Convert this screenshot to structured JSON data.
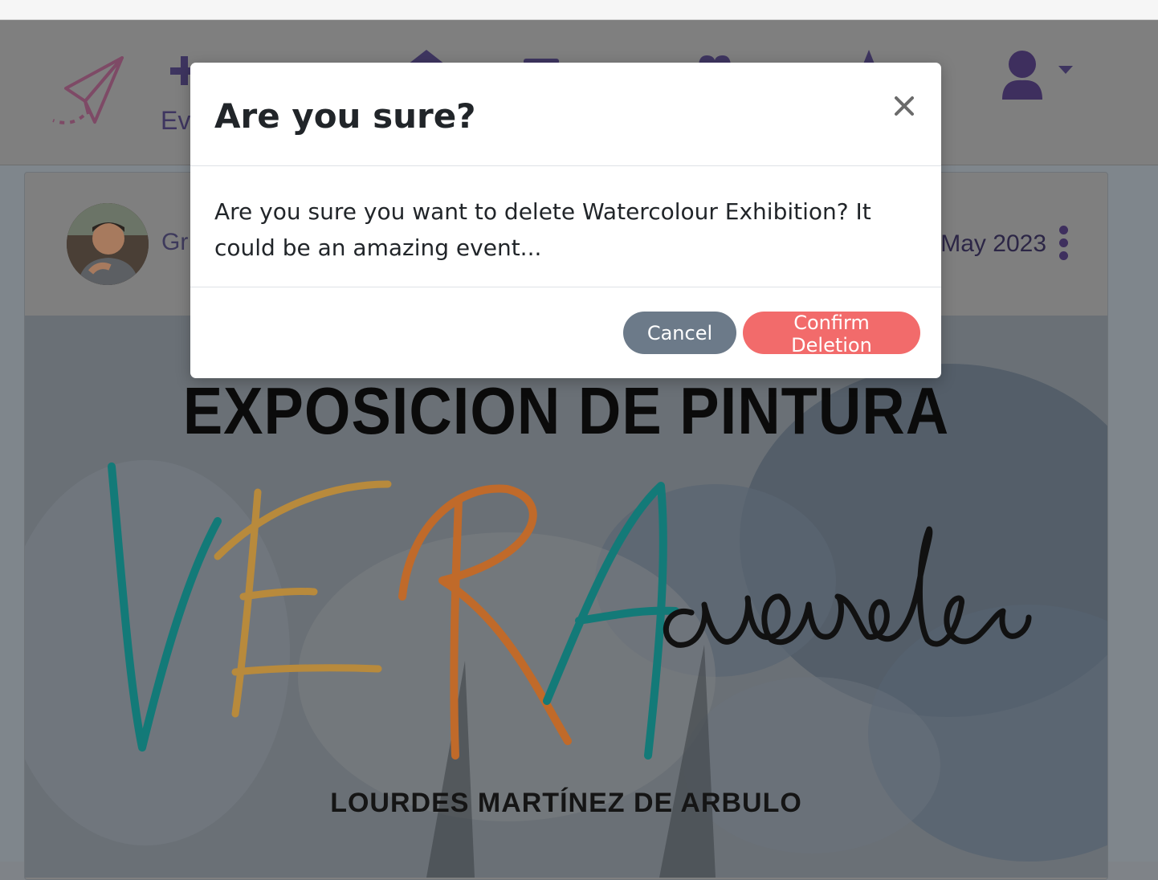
{
  "navbar": {
    "events_label": "Ev",
    "icons": [
      "paper-plane-logo",
      "plus-icon",
      "home-icon",
      "menu-icon",
      "heart-icon",
      "star-icon",
      "user-icon",
      "caret-down-icon"
    ]
  },
  "card": {
    "author_name": "Gr",
    "date": "May 2023",
    "poster": {
      "title": "EXPOSICION DE PINTURA",
      "script_parts": [
        "VE",
        "R",
        "A",
        "cuarela"
      ],
      "artist": "LOURDES MARTÍNEZ DE ARBULO"
    }
  },
  "modal": {
    "title": "Are you sure?",
    "body": "Are you sure you want to delete Watercolour Exhibition? It could be an amazing event...",
    "cancel_label": "Cancel",
    "confirm_label": "Confirm Deletion",
    "colors": {
      "cancel": "#6c7a89",
      "confirm": "#f26b6b"
    }
  }
}
